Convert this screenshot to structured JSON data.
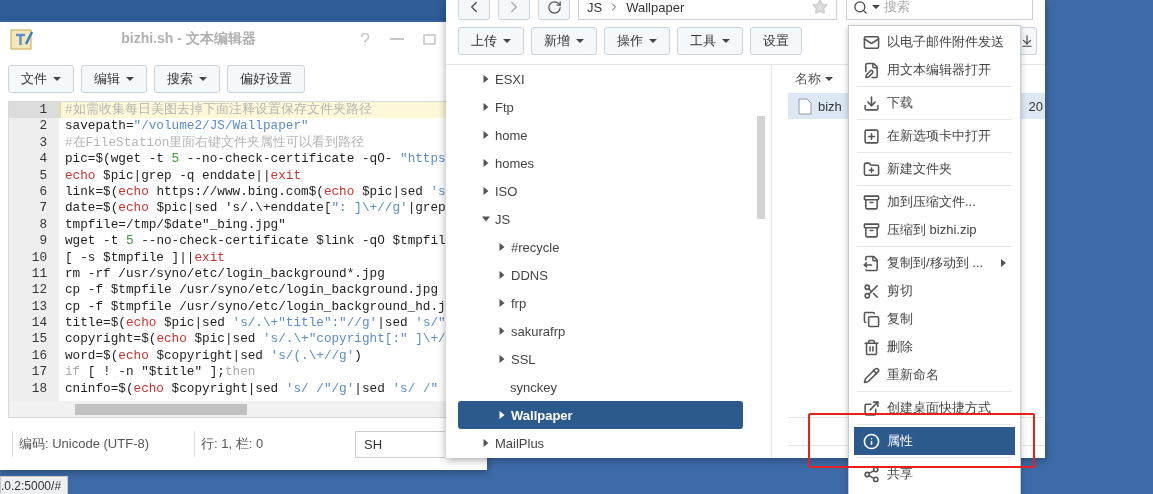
{
  "editor": {
    "title": "bizhi.sh - 文本编辑器",
    "menus": [
      {
        "label": "文件",
        "dropdown": true
      },
      {
        "label": "编辑",
        "dropdown": true
      },
      {
        "label": "搜索",
        "dropdown": true
      },
      {
        "label": "偏好设置",
        "dropdown": false
      }
    ],
    "lines": [
      {
        "number": "1",
        "current": true,
        "tokens": [
          {
            "kind": "comment",
            "text": "#如需收集每日美图去掉下面注释设置保存文件夹路径"
          }
        ]
      },
      {
        "number": "2",
        "current": false,
        "tokens": [
          {
            "kind": "plain",
            "text": "savepath="
          },
          {
            "kind": "string",
            "text": "\"/volume2/JS/Wallpaper\""
          }
        ]
      },
      {
        "number": "3",
        "current": false,
        "tokens": [
          {
            "kind": "comment",
            "text": "#在FileStation里面右键文件夹属性可以看到路径"
          }
        ]
      },
      {
        "number": "4",
        "current": false,
        "tokens": [
          {
            "kind": "plain",
            "text": "pic=$(wget -t "
          },
          {
            "kind": "number",
            "text": "5"
          },
          {
            "kind": "plain",
            "text": " --no-check-certificate -qO- "
          },
          {
            "kind": "string",
            "text": "\"https"
          }
        ]
      },
      {
        "number": "5",
        "current": false,
        "tokens": [
          {
            "kind": "keyword",
            "text": "echo"
          },
          {
            "kind": "plain",
            "text": " $pic|grep -q enddate||"
          },
          {
            "kind": "keyword",
            "text": "exit"
          }
        ]
      },
      {
        "number": "6",
        "current": false,
        "tokens": [
          {
            "kind": "plain",
            "text": "link=$("
          },
          {
            "kind": "keyword",
            "text": "echo"
          },
          {
            "kind": "plain",
            "text": " https://www.bing.com$("
          },
          {
            "kind": "keyword",
            "text": "echo"
          },
          {
            "kind": "plain",
            "text": " $pic|sed "
          },
          {
            "kind": "string",
            "text": "'s"
          }
        ]
      },
      {
        "number": "7",
        "current": false,
        "tokens": [
          {
            "kind": "plain",
            "text": "date=$("
          },
          {
            "kind": "keyword",
            "text": "echo"
          },
          {
            "kind": "plain",
            "text": " $pic|sed 's/.\\+enddate["
          },
          {
            "kind": "string",
            "text": "\": ]\\+//g'"
          },
          {
            "kind": "plain",
            "text": "|grep"
          }
        ]
      },
      {
        "number": "8",
        "current": false,
        "tokens": [
          {
            "kind": "plain",
            "text": "tmpfile=/tmp/$date\"_bing.jpg\""
          }
        ]
      },
      {
        "number": "9",
        "current": false,
        "tokens": [
          {
            "kind": "plain",
            "text": "wget -t "
          },
          {
            "kind": "number",
            "text": "5"
          },
          {
            "kind": "plain",
            "text": " --no-check-certificate $link -qO $tmpfil"
          }
        ]
      },
      {
        "number": "10",
        "current": false,
        "tokens": [
          {
            "kind": "plain",
            "text": "[ -s $tmpfile ]||"
          },
          {
            "kind": "keyword",
            "text": "exit"
          }
        ]
      },
      {
        "number": "11",
        "current": false,
        "tokens": [
          {
            "kind": "plain",
            "text": "rm -rf /usr/syno/etc/login_background*.jpg"
          }
        ]
      },
      {
        "number": "12",
        "current": false,
        "tokens": [
          {
            "kind": "plain",
            "text": "cp -f $tmpfile /usr/syno/etc/login_background.jpg"
          }
        ]
      },
      {
        "number": "13",
        "current": false,
        "tokens": [
          {
            "kind": "plain",
            "text": "cp -f $tmpfile /usr/syno/etc/login_background_hd.j"
          }
        ]
      },
      {
        "number": "14",
        "current": false,
        "tokens": [
          {
            "kind": "plain",
            "text": "title=$("
          },
          {
            "kind": "keyword",
            "text": "echo"
          },
          {
            "kind": "plain",
            "text": " $pic|sed "
          },
          {
            "kind": "string",
            "text": "'s/.\\+\"title\":\"//g'"
          },
          {
            "kind": "plain",
            "text": "|sed "
          },
          {
            "kind": "string",
            "text": "'s/\""
          }
        ]
      },
      {
        "number": "15",
        "current": false,
        "tokens": [
          {
            "kind": "plain",
            "text": "copyright=$("
          },
          {
            "kind": "keyword",
            "text": "echo"
          },
          {
            "kind": "plain",
            "text": " $pic|sed "
          },
          {
            "kind": "string",
            "text": "'s/.\\+\"copyright[:\" ]\\+/"
          }
        ]
      },
      {
        "number": "16",
        "current": false,
        "tokens": [
          {
            "kind": "plain",
            "text": "word=$("
          },
          {
            "kind": "keyword",
            "text": "echo"
          },
          {
            "kind": "plain",
            "text": " $copyright|sed "
          },
          {
            "kind": "string",
            "text": "'s/(.\\+//g'"
          },
          {
            "kind": "plain",
            "text": ")"
          }
        ]
      },
      {
        "number": "17",
        "current": false,
        "tokens": [
          {
            "kind": "control",
            "text": "if"
          },
          {
            "kind": "plain",
            "text": " [ ! -n \"$title\" ];"
          },
          {
            "kind": "control",
            "text": "then"
          }
        ]
      },
      {
        "number": "18",
        "current": false,
        "tokens": [
          {
            "kind": "plain",
            "text": "cninfo=$("
          },
          {
            "kind": "keyword",
            "text": "echo"
          },
          {
            "kind": "plain",
            "text": " $copyright|sed "
          },
          {
            "kind": "string",
            "text": "'s/ /\"/g'"
          },
          {
            "kind": "plain",
            "text": "|sed "
          },
          {
            "kind": "string",
            "text": "'s/ /\""
          }
        ]
      }
    ],
    "status": {
      "encoding": "编码: Unicode (UTF-8)",
      "position": "行: 1, 栏: 0",
      "language": "SH"
    }
  },
  "file_station": {
    "path": [
      "JS",
      "Wallpaper"
    ],
    "search": {
      "placeholder": "搜索"
    },
    "toolbar": [
      {
        "label": "上传",
        "dropdown": true
      },
      {
        "label": "新增",
        "dropdown": true
      },
      {
        "label": "操作",
        "dropdown": true
      },
      {
        "label": "工具",
        "dropdown": true
      },
      {
        "label": "设置",
        "dropdown": false
      }
    ],
    "tree": [
      {
        "label": "ESXI",
        "expandable": true,
        "expanded": false,
        "selected": false
      },
      {
        "label": "Ftp",
        "expandable": true,
        "expanded": false,
        "selected": false
      },
      {
        "label": "home",
        "expandable": true,
        "expanded": false,
        "selected": false
      },
      {
        "label": "homes",
        "expandable": true,
        "expanded": false,
        "selected": false
      },
      {
        "label": "ISO",
        "expandable": true,
        "expanded": false,
        "selected": false
      },
      {
        "label": "JS",
        "expandable": true,
        "expanded": true,
        "selected": false,
        "children": [
          {
            "label": "#recycle",
            "expandable": true,
            "expanded": false,
            "selected": false
          },
          {
            "label": "DDNS",
            "expandable": true,
            "expanded": false,
            "selected": false
          },
          {
            "label": "frp",
            "expandable": true,
            "expanded": false,
            "selected": false
          },
          {
            "label": "sakurafrp",
            "expandable": true,
            "expanded": false,
            "selected": false
          },
          {
            "label": "SSL",
            "expandable": true,
            "expanded": false,
            "selected": false
          },
          {
            "label": "synckey",
            "expandable": false,
            "expanded": false,
            "selected": false
          },
          {
            "label": "Wallpaper",
            "expandable": true,
            "expanded": false,
            "selected": true
          }
        ]
      },
      {
        "label": "MailPlus",
        "expandable": true,
        "expanded": false,
        "selected": false
      }
    ],
    "list": {
      "column": "名称",
      "rows": [
        {
          "name": "bizh",
          "date": "20",
          "selected": true
        }
      ]
    }
  },
  "context_menu": {
    "groups": [
      [
        {
          "label": "以电子邮件附件发送",
          "selected": false,
          "submenu": false
        },
        {
          "label": "用文本编辑器打开",
          "selected": false,
          "submenu": false
        }
      ],
      [
        {
          "label": "下载",
          "selected": false,
          "submenu": false
        }
      ],
      [
        {
          "label": "在新选项卡中打开",
          "selected": false,
          "submenu": false
        }
      ],
      [
        {
          "label": "新建文件夹",
          "selected": false,
          "submenu": false
        }
      ],
      [
        {
          "label": "加到压缩文件...",
          "selected": false,
          "submenu": false
        },
        {
          "label": "压缩到 bizhi.zip",
          "selected": false,
          "submenu": false
        }
      ],
      [
        {
          "label": "复制到/移动到 ...",
          "selected": false,
          "submenu": true
        },
        {
          "label": "剪切",
          "selected": false,
          "submenu": false
        },
        {
          "label": "复制",
          "selected": false,
          "submenu": false
        },
        {
          "label": "删除",
          "selected": false,
          "submenu": false
        },
        {
          "label": "重新命名",
          "selected": false,
          "submenu": false
        }
      ],
      [
        {
          "label": "创建桌面快捷方式",
          "selected": false,
          "submenu": false
        }
      ],
      [
        {
          "label": "属性",
          "selected": true,
          "submenu": false
        }
      ],
      [
        {
          "label": "共享",
          "selected": false,
          "submenu": false
        }
      ]
    ]
  },
  "browser_status": {
    "url": ".0.2:5000/#"
  }
}
